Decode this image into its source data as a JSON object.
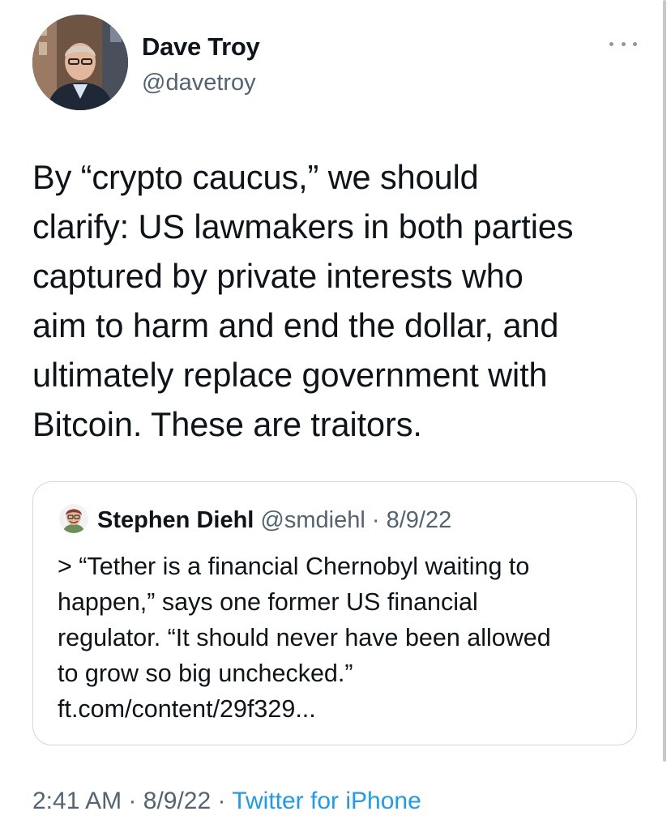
{
  "tweet": {
    "author": {
      "name": "Dave Troy",
      "handle": "@davetroy"
    },
    "text": "By “crypto caucus,” we should\nclarify: US lawmakers in both parties\ncaptured by private interests who\naim to harm and end the dollar, and\nultimately replace government with\nBitcoin. These are traitors.",
    "quoted": {
      "name": "Stephen Diehl",
      "handle": "@smdiehl",
      "separator": "·",
      "date": "8/9/22",
      "text": "> “Tether is a financial Chernobyl waiting to\nhappen,” says one former US financial\nregulator. “It should never have been allowed\nto grow so big unchecked.”\nft.com/content/29f329..."
    },
    "footer": {
      "time": "2:41 AM",
      "separator": "·",
      "date": "8/9/22",
      "source": "Twitter for iPhone"
    },
    "icons": {
      "more": "more-horizontal-icon"
    },
    "colors": {
      "text": "#0f1419",
      "secondary": "#536471",
      "link": "#1d9bf0",
      "border": "#cfd9de"
    }
  }
}
